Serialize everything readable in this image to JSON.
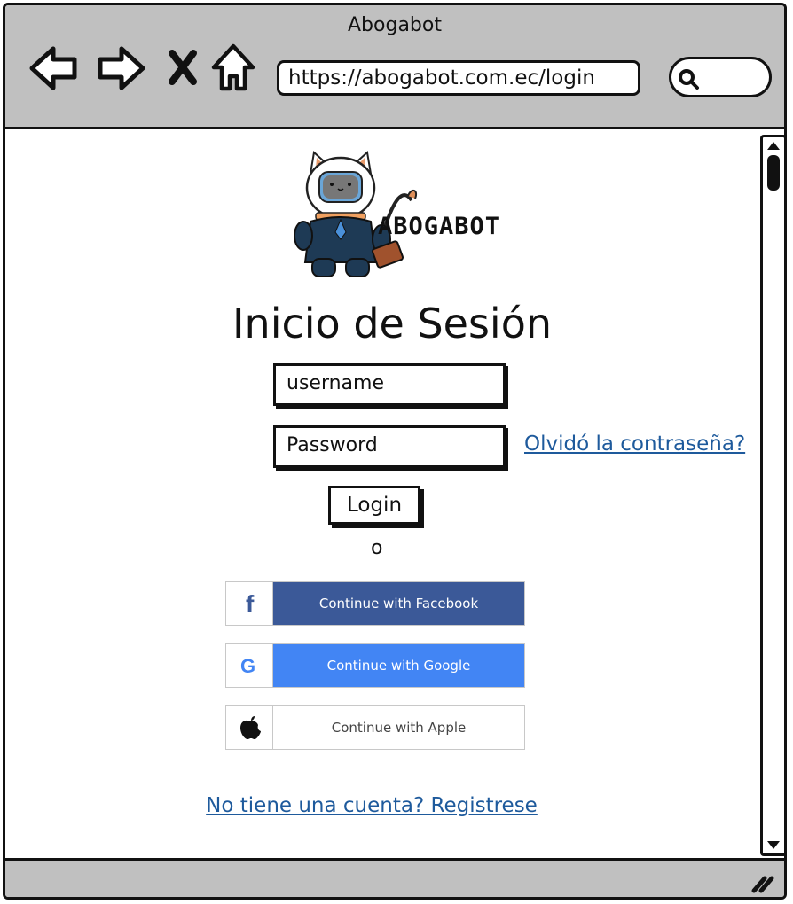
{
  "window": {
    "title": "Abogabot"
  },
  "toolbar": {
    "back_icon": "arrow-left-icon",
    "forward_icon": "arrow-right-icon",
    "stop_icon": "close-icon",
    "home_icon": "home-icon",
    "search_icon": "search-icon"
  },
  "address_bar": {
    "url": "https://abogabot.com.ec/login"
  },
  "logo": {
    "text": "ABOGABOT"
  },
  "login": {
    "heading": "Inicio de Sesión",
    "username_placeholder": "username",
    "password_placeholder": "Password",
    "forgot_link": "Olvidó la contraseña?",
    "button": "Login",
    "separator": "o"
  },
  "social": [
    {
      "label": "Continue with Facebook",
      "icon": "facebook-icon",
      "color": "#3b5998",
      "text_color": "#ffffff"
    },
    {
      "label": "Continue with Google",
      "icon": "google-icon",
      "color": "#4285f4",
      "text_color": "#ffffff"
    },
    {
      "label": "Continue with Apple",
      "icon": "apple-icon",
      "color": "#ffffff",
      "text_color": "#444444"
    }
  ],
  "register_link": "No tiene una cuenta? Registrese",
  "colors": {
    "link": "#1e5a9c",
    "chrome": "#c0c0c0"
  }
}
